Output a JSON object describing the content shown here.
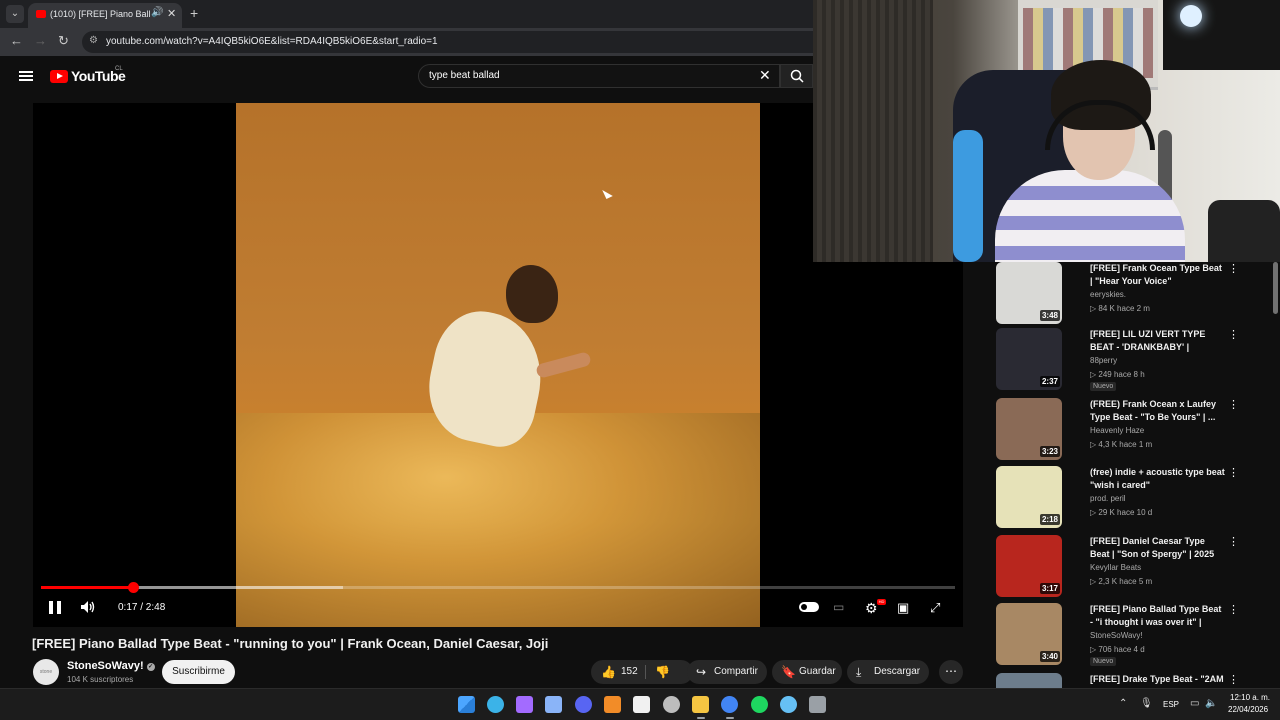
{
  "browser": {
    "tab_title": "(1010) [FREE] Piano Ballad T",
    "url": "youtube.com/watch?v=A4IQB5kiO6E&list=RDA4IQB5kiO6E&start_radio=1",
    "icons": {
      "tab_menu": "chevron-down-icon",
      "audio": "speaker-icon",
      "close": "close-icon",
      "new_tab": "plus-icon",
      "back": "arrow-left-icon",
      "forward": "arrow-right-icon",
      "reload": "reload-icon",
      "site_info": "tune-icon"
    }
  },
  "youtube": {
    "logo_text": "YouTube",
    "country_code": "CL",
    "search_query": "type beat ballad"
  },
  "player": {
    "current_time": "0:17 / 2:48",
    "progress_fraction": 0.101,
    "buffered_fraction": 0.33
  },
  "video": {
    "title": "[FREE] Piano Ballad Type Beat - \"running to you\" | Frank Ocean, Daniel Caesar, Joji",
    "channel": "StoneSoWavy!",
    "channel_avatar_text": "stone",
    "subscribers": "104 K suscriptores",
    "subscribe_label": "Suscribirme",
    "likes": "152",
    "share_label": "Compartir",
    "save_label": "Guardar",
    "download_label": "Descargar"
  },
  "recommendations": [
    {
      "title": "[FREE] Frank Ocean Type Beat | \"Hear Your Voice\"",
      "channel": "eeryskies.",
      "meta": "▷ 84 K  hace 2 m",
      "duration": "3:48",
      "badge": "",
      "thumb": "#d9d9d6"
    },
    {
      "title": "[FREE] LIL UZI VERT TYPE BEAT - 'DRANKBABY' | FUTURISTIC",
      "channel": "88perry",
      "meta": "▷ 249  hace 8 h",
      "duration": "2:37",
      "badge": "Nuevo",
      "thumb": "#2a2a33"
    },
    {
      "title": "(FREE) Frank Ocean x Laufey Type Beat - \"To Be Yours\" | ...",
      "channel": "Heavenly Haze",
      "meta": "▷ 4,3 K  hace 1 m",
      "duration": "3:23",
      "badge": "",
      "thumb": "#8a6a56"
    },
    {
      "title": "(free) indie + acoustic type beat \"wish i cared\"",
      "channel": "prod. peril",
      "meta": "▷ 29 K  hace 10 d",
      "duration": "2:18",
      "badge": "",
      "thumb": "#e6e2b8"
    },
    {
      "title": "[FREE] Daniel Caesar Type Beat | \"Son of Spergy\" | 2025",
      "channel": "Kevyllar Beats",
      "meta": "▷ 2,3 K  hace 5 m",
      "duration": "3:17",
      "badge": "",
      "thumb": "#b8261e"
    },
    {
      "title": "[FREE] Piano Ballad Type Beat - \"i thought i was over it\" | Frank ...",
      "channel": "StoneSoWavy!",
      "meta": "▷ 706  hace 4 d",
      "duration": "3:40",
      "badge": "Nuevo",
      "thumb": "#a88864"
    },
    {
      "title": "[FREE] Drake Type Beat - \"2AM",
      "channel": "",
      "meta": "",
      "duration": "",
      "badge": "",
      "thumb": "#6d7d8c"
    }
  ],
  "taskbar": {
    "language": "ESP",
    "time": "12:10 a. m.",
    "date": "22/04/2026",
    "colors": [
      "#4ca6ff",
      "#3bb3e8",
      "#a36bff",
      "#8ab4f8",
      "#5865f2",
      "#f28c28",
      "#f1f1f1",
      "#bdbdbd",
      "#f5c542",
      "#4285f4",
      "#1ed760",
      "#66c0f4",
      "#9aa0a6"
    ]
  }
}
